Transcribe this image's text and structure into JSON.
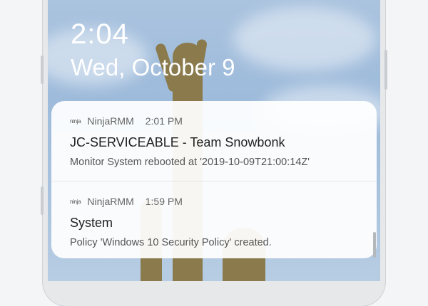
{
  "lockscreen": {
    "time": "2:04",
    "date": "Wed, October 9"
  },
  "notifications": [
    {
      "app_icon": "ninja",
      "app_name": "NinjaRMM",
      "time": "2:01 PM",
      "title": "JC-SERVICEABLE - Team Snowbonk",
      "body": "Monitor System rebooted at '2019-10-09T21:00:14Z'"
    },
    {
      "app_icon": "ninja",
      "app_name": "NinjaRMM",
      "time": "1:59 PM",
      "title": "System",
      "body": "Policy 'Windows 10 Security Policy' created."
    }
  ]
}
